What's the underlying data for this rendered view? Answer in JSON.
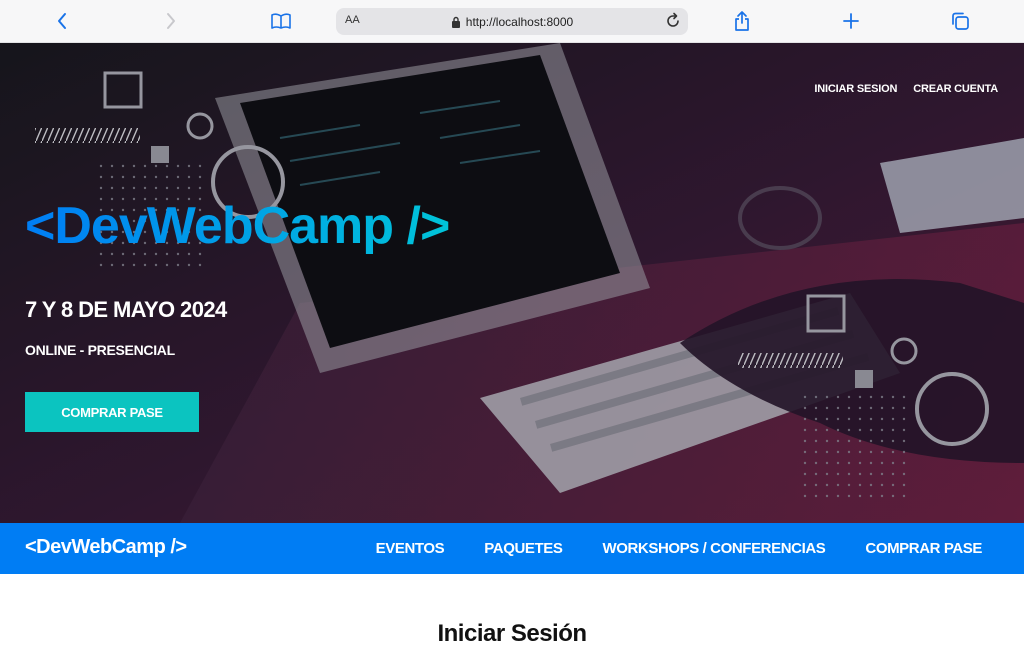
{
  "browser": {
    "text_size_label": "AA",
    "url": "http://localhost:8000"
  },
  "header": {
    "login_link": "INICIAR SESION",
    "register_link": "CREAR CUENTA",
    "logo": "<DevWebCamp />",
    "date": "7 Y 8 DE MAYO 2024",
    "mode": "ONLINE - PRESENCIAL",
    "cta": "COMPRAR PASE"
  },
  "nav": {
    "logo": "<DevWebCamp />",
    "items": [
      {
        "label": "EVENTOS"
      },
      {
        "label": "PAQUETES"
      },
      {
        "label": "WORKSHOPS / CONFERENCIAS"
      },
      {
        "label": "COMPRAR PASE"
      }
    ]
  },
  "main": {
    "heading": "Iniciar Sesión"
  },
  "colors": {
    "brand_blue": "#007df4",
    "cta_teal": "#0bc4c0",
    "hero_bg": "#15141c"
  }
}
